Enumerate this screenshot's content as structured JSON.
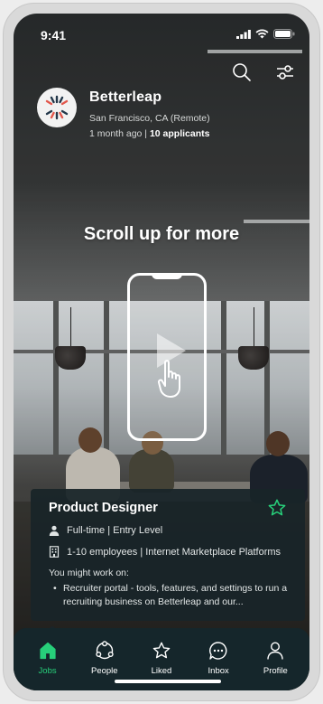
{
  "status_bar": {
    "time": "9:41"
  },
  "company": {
    "name": "Betterleap",
    "location": "San Francisco, CA (Remote)",
    "posted": "1 month ago",
    "separator": " | ",
    "applicants": "10 applicants"
  },
  "hint": {
    "text": "Scroll up for more"
  },
  "job": {
    "title": "Product Designer",
    "employment": "Full-time | Entry Level",
    "company_info": "1-10 employees | Internet Marketplace Platforms",
    "work_heading": "You might work on:",
    "work_item": "Recruiter portal - tools, features, and settings to run a recruiting business on Betterleap and our..."
  },
  "tabs": [
    {
      "label": "Jobs",
      "icon": "home-icon",
      "active": true
    },
    {
      "label": "People",
      "icon": "people-icon",
      "active": false
    },
    {
      "label": "Liked",
      "icon": "star-icon",
      "active": false
    },
    {
      "label": "Inbox",
      "icon": "chat-icon",
      "active": false
    },
    {
      "label": "Profile",
      "icon": "profile-icon",
      "active": false
    }
  ],
  "colors": {
    "accent": "#27cf7a",
    "card_bg": "#182428",
    "tabbar_bg": "#15262b"
  }
}
